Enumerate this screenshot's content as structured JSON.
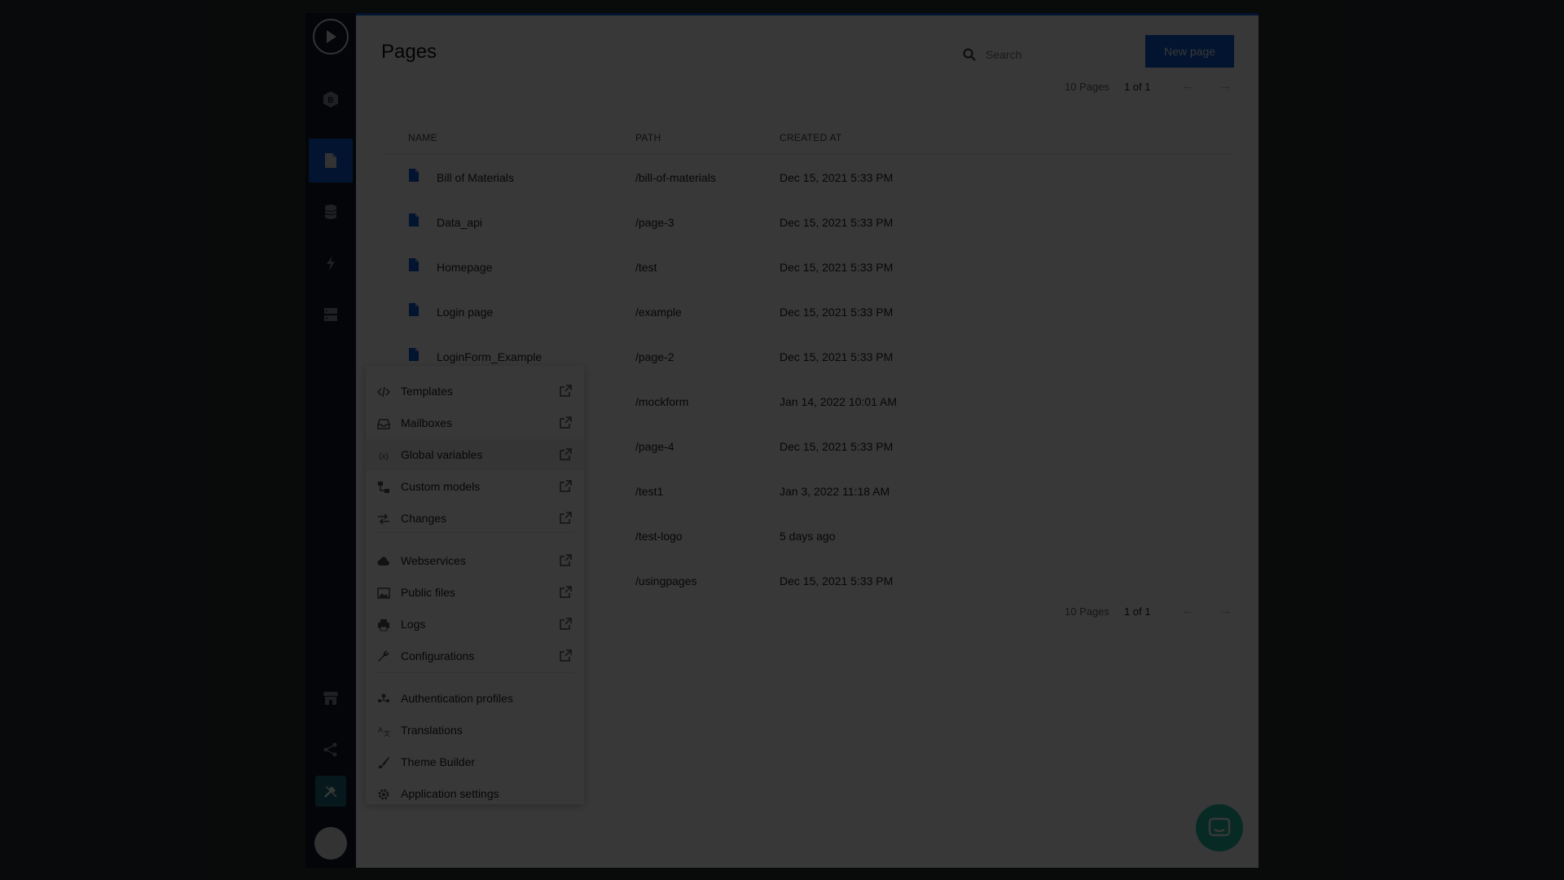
{
  "page": {
    "title": "Pages",
    "new_button": "New page"
  },
  "search": {
    "placeholder": "Search"
  },
  "pagination_top": {
    "count": "10 Pages",
    "page": "1 of 1",
    "prev": "←",
    "next": "→"
  },
  "pagination_bottom": {
    "count": "10 Pages",
    "page": "1 of 1",
    "prev": "←",
    "next": "→"
  },
  "table": {
    "headers": {
      "name": "NAME",
      "path": "PATH",
      "created": "CREATED AT"
    },
    "rows": [
      {
        "name": "Bill of Materials",
        "path": "/bill-of-materials",
        "created": "Dec 15, 2021 5:33 PM"
      },
      {
        "name": "Data_api",
        "path": "/page-3",
        "created": "Dec 15, 2021 5:33 PM"
      },
      {
        "name": "Homepage",
        "path": "/test",
        "created": "Dec 15, 2021 5:33 PM"
      },
      {
        "name": "Login page",
        "path": "/example",
        "created": "Dec 15, 2021 5:33 PM"
      },
      {
        "name": "LoginForm_Example",
        "path": "/page-2",
        "created": "Dec 15, 2021 5:33 PM"
      },
      {
        "name": "",
        "path": "/mockform",
        "created": "Jan 14, 2022 10:01 AM"
      },
      {
        "name": "",
        "path": "/page-4",
        "created": "Dec 15, 2021 5:33 PM"
      },
      {
        "name": "",
        "path": "/test1",
        "created": "Jan 3, 2022 11:18 AM"
      },
      {
        "name": "",
        "path": "/test-logo",
        "created": "5 days ago"
      },
      {
        "name": "",
        "path": "/usingpages",
        "created": "Dec 15, 2021 5:33 PM"
      }
    ]
  },
  "menu": {
    "items": [
      {
        "label": "Templates",
        "icon": "code-icon",
        "external": true
      },
      {
        "label": "Mailboxes",
        "icon": "inbox-icon",
        "external": true
      },
      {
        "label": "Global variables",
        "icon": "variable-icon",
        "external": true,
        "highlighted": true
      },
      {
        "label": "Custom models",
        "icon": "models-icon",
        "external": true
      },
      {
        "label": "Changes",
        "icon": "changes-icon",
        "external": true
      },
      {
        "label": "Webservices",
        "icon": "cloud-icon",
        "external": true
      },
      {
        "label": "Public files",
        "icon": "image-icon",
        "external": true
      },
      {
        "label": "Logs",
        "icon": "printer-icon",
        "external": true
      },
      {
        "label": "Configurations",
        "icon": "wrench-icon",
        "external": true
      },
      {
        "label": "Authentication profiles",
        "icon": "users-icon",
        "external": false
      },
      {
        "label": "Translations",
        "icon": "translate-icon",
        "external": false
      },
      {
        "label": "Theme Builder",
        "icon": "brush-icon",
        "external": false
      },
      {
        "label": "Application settings",
        "icon": "gear-icon",
        "external": false
      }
    ]
  },
  "sidebar": {
    "icons": [
      "play-logo-icon",
      "app-badge-icon",
      "pages-icon",
      "database-icon",
      "bolt-icon",
      "server-icon",
      "store-icon",
      "share-icon",
      "tools-icon",
      "avatar"
    ],
    "badge_letter": "B"
  },
  "colors": {
    "accent": "#0d5ad6",
    "rail": "#16182a",
    "chat": "#22c0a5",
    "overlay": "rgba(0,0,0,0.78)"
  }
}
